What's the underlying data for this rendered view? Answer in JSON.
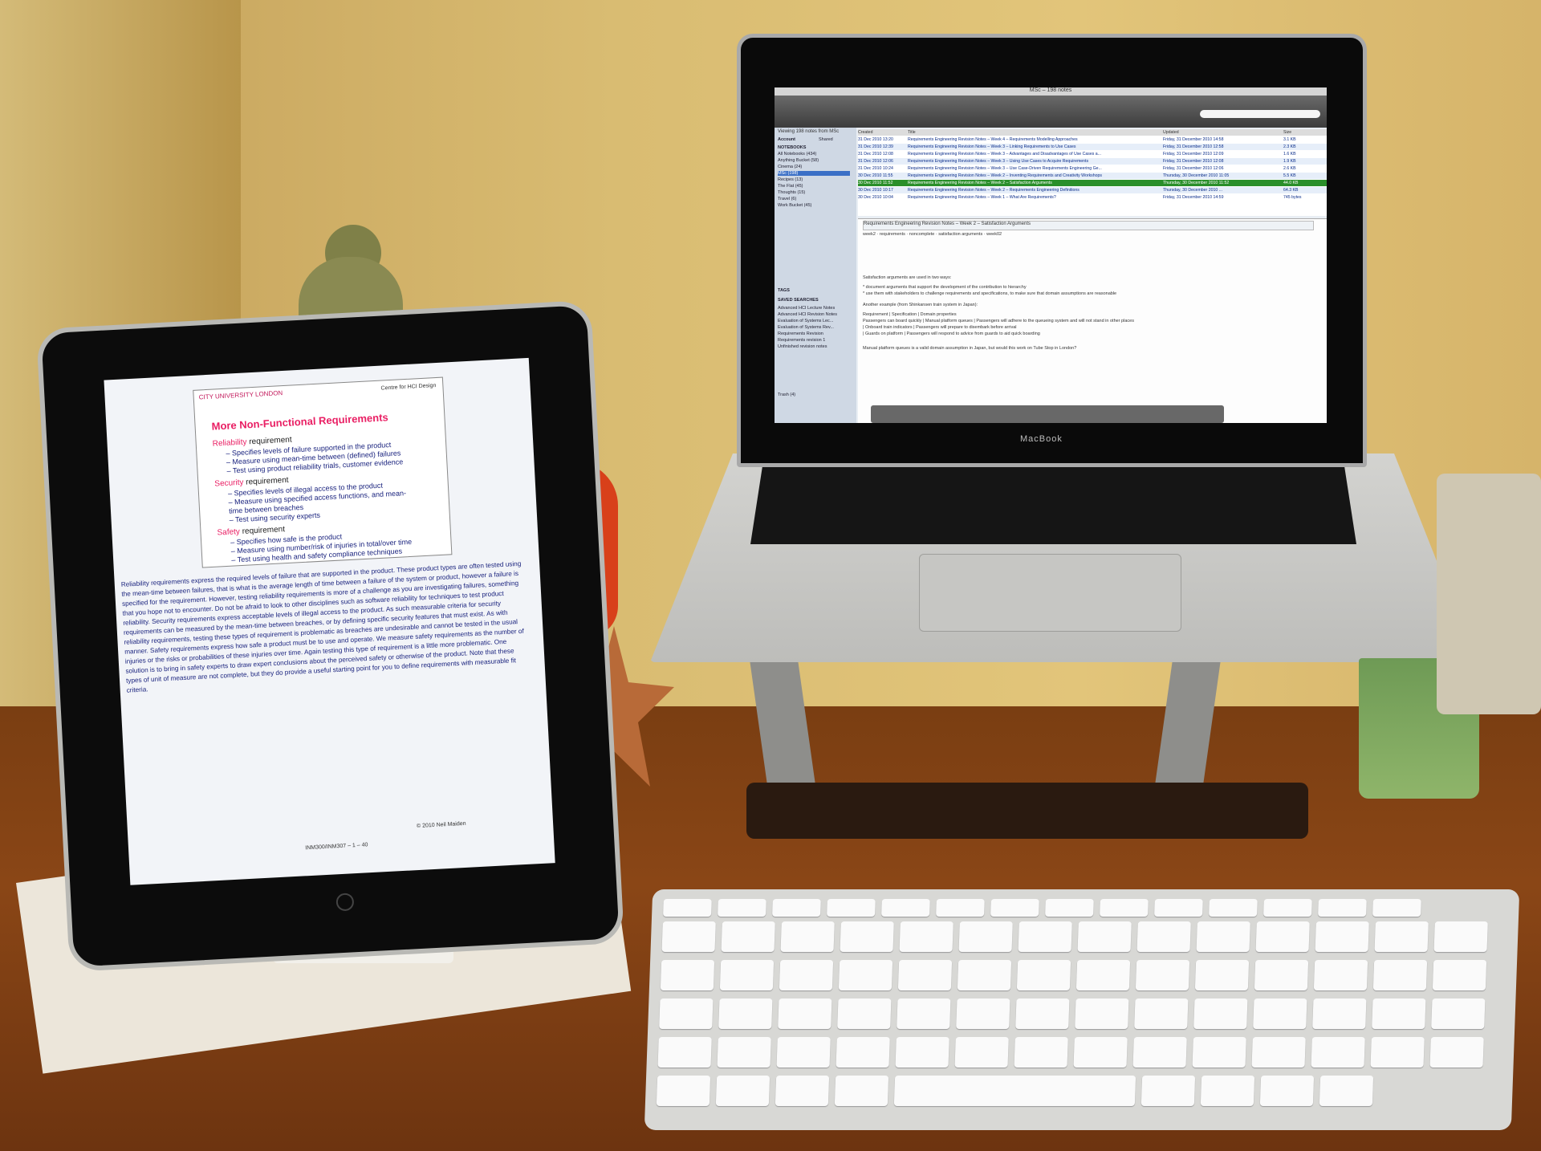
{
  "ipad": {
    "doc": {
      "header_left": "CITY UNIVERSITY LONDON",
      "header_right": "Centre for HCI Design",
      "title": "More Non-Functional Requirements",
      "requirements": [
        {
          "name": "Reliability",
          "suffix": " requirement",
          "bullets": [
            "– Specifies levels of failure supported in the product",
            "– Measure using mean-time between (defined) failures",
            "– Test using product reliability trials, customer evidence"
          ]
        },
        {
          "name": "Security",
          "suffix": " requirement",
          "bullets": [
            "– Specifies levels of illegal access to the product",
            "– Measure using specified access functions, and mean-",
            "  time between breaches",
            "– Test using security experts"
          ]
        },
        {
          "name": "Safety",
          "suffix": " requirement",
          "bullets": [
            "– Specifies how safe is the product",
            "– Measure using number/risk of injuries in total/over time",
            "– Test using health and safety compliance techniques"
          ]
        }
      ],
      "body": "Reliability requirements express the required levels of failure that are supported in the product. These product types are often tested using the mean-time between failures, that is what is the average length of time between a failure of the system or product, however a failure is specified for the requirement. However, testing reliability requirements is more of a challenge as you are investigating failures, something that you hope not to encounter. Do not be afraid to look to other disciplines such as software reliability for techniques to test product reliability. Security requirements express acceptable levels of illegal access to the product. As such measurable criteria for security requirements can be measured by the mean-time between breaches, or by defining specific security features that must exist. As with reliability requirements, testing these types of requirement is problematic as breaches are undesirable and cannot be tested in the usual manner. Safety requirements express how safe a product must be to use and operate. We measure safety requirements as the number of injuries or the risks or probabilities of these injuries over time. Again testing this type of requirement is a little more problematic. One solution is to bring in safety experts to draw expert conclusions about the perceived safety or otherwise of the product. Note that these types of unit of measure are not complete, but they do provide a useful starting point for you to define requirements with measurable fit criteria.",
      "copyright": "© 2010 Neil Maiden",
      "page": "INM300/INM307 – 1 – 40"
    }
  },
  "macbook": {
    "brand": "MacBook",
    "app": {
      "title": "MSc – 198 notes",
      "viewing": "Viewing 198 notes from MSc",
      "tabs": [
        "Account",
        "Shared"
      ],
      "sidebar_heading": "NOTEBOOKS",
      "notebooks": [
        {
          "label": "All Notebooks (434)",
          "selected": false
        },
        {
          "label": "Anything Bucket (58)",
          "selected": false
        },
        {
          "label": "Cinema (24)",
          "selected": false
        },
        {
          "label": "MSc (198)",
          "selected": true
        },
        {
          "label": "Recipes (13)",
          "selected": false
        },
        {
          "label": "The Flat (45)",
          "selected": false
        },
        {
          "label": "Thoughts (15)",
          "selected": false
        },
        {
          "label": "Travel (6)",
          "selected": false
        },
        {
          "label": "Work Bucket (45)",
          "selected": false
        }
      ],
      "tags_heading": "TAGS",
      "searches_heading": "SAVED SEARCHES",
      "searches": [
        "Advanced HCI Lecture Notes",
        "Advanced HCI Revision Notes",
        "Evaluation of Systems Lec...",
        "Evaluation of Systems Rev...",
        "Requirements Revision",
        "Requirements revision 1",
        "Unfinished revision notes"
      ],
      "trash": "Trash (4)",
      "columns": [
        "Created",
        "Title",
        "Updated",
        "Size"
      ],
      "notes": [
        {
          "created": "31 Dec 2010 13:20",
          "title": "Requirements Engineering Revision Notes – Week 4 – Requirements Modelling Approaches",
          "updated": "Friday, 31 December 2010 14:58",
          "size": "3.1 KB",
          "selected": false
        },
        {
          "created": "31 Dec 2010 12:39",
          "title": "Requirements Engineering Revision Notes – Week 3 – Linking Requirements to Use Cases",
          "updated": "Friday, 31 December 2010 12:58",
          "size": "2.3 KB",
          "selected": false
        },
        {
          "created": "31 Dec 2010 12:08",
          "title": "Requirements Engineering Revision Notes – Week 3 – Advantages and Disadvantages of Use Cases a...",
          "updated": "Friday, 31 December 2010 12:09",
          "size": "1.6 KB",
          "selected": false
        },
        {
          "created": "31 Dec 2010 12:06",
          "title": "Requirements Engineering Revision Notes – Week 3 – Using Use Cases to Acquire Requirements",
          "updated": "Friday, 31 December 2010 12:08",
          "size": "1.9 KB",
          "selected": false
        },
        {
          "created": "31 Dec 2010 10:24",
          "title": "Requirements Engineering Revision Notes – Week 3 – Use Case-Driven Requirements Engineering Ge...",
          "updated": "Friday, 31 December 2010 12:06",
          "size": "2.6 KB",
          "selected": false
        },
        {
          "created": "30 Dec 2010 11:55",
          "title": "Requirements Engineering Revision Notes – Week 2 – Inventing Requirements and Creativity Workshops",
          "updated": "Thursday, 30 December 2010 11:05",
          "size": "5.5 KB",
          "selected": false
        },
        {
          "created": "30 Dec 2010 11:52",
          "title": "Requirements Engineering Revision Notes – Week 2 – Satisfaction Arguments",
          "updated": "Thursday, 30 December 2010 11:52",
          "size": "44.0 KB",
          "selected": true
        },
        {
          "created": "30 Dec 2010 10:17",
          "title": "Requirements Engineering Revision Notes – Week 2 – Requirements Engineering Definitions",
          "updated": "Thursday, 30 December 2010 ...",
          "size": "64.3 KB",
          "selected": false
        },
        {
          "created": "30 Dec 2010 10:04",
          "title": "Requirements Engineering Revision Notes – Week 1 – What Are Requirements?",
          "updated": "Friday, 31 December 2010 14:59",
          "size": "745 bytes",
          "selected": false
        }
      ],
      "note_title": "Requirements Engineering Revision Notes – Week 2 – Satisfaction Arguments",
      "note_tags": [
        "week2",
        "requirements",
        "noncomplete",
        "satisfaction arguments",
        "week02"
      ],
      "note_lines": [
        "Satisfaction arguments are used in two ways:",
        "* document arguments that support the development of the contribution to hierarchy",
        "* use them with stakeholders to challenge requirements and specifications, to make sure that domain assumptions are reasonable",
        "Another example (from Shinkansen train system in Japan):",
        "Requirement | Specification | Domain properties",
        "Passengers can board quickly | Manual platform queues | Passengers will adhere to the queueing system and will not stand in other places",
        "                | Onboard train indicators | Passengers will prepare to disembark before arrival",
        "                | Guards on platform | Passengers will respond to advice from guards to aid quick boarding",
        "Manual platform queues is a valid domain assumption in Japan, but would this work on Tube Stop in London?"
      ]
    }
  },
  "keyboard": {
    "rows": 6
  }
}
